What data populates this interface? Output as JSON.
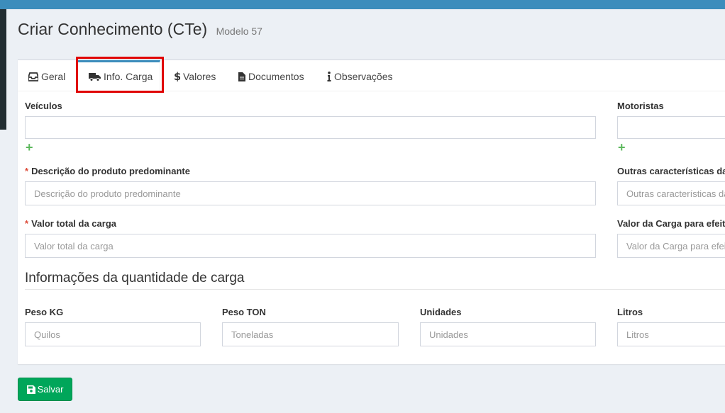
{
  "header": {
    "title": "Criar Conhecimento (CTe)",
    "subtitle": "Modelo 57"
  },
  "tabs": [
    {
      "label": "Geral",
      "icon": "inbox-icon"
    },
    {
      "label": "Info. Carga",
      "icon": "truck-icon"
    },
    {
      "label": "Valores",
      "icon": "dollar-icon"
    },
    {
      "label": "Documentos",
      "icon": "document-icon"
    },
    {
      "label": "Observações",
      "icon": "info-icon"
    }
  ],
  "fields": {
    "veiculos": {
      "label": "Veículos",
      "value": ""
    },
    "motoristas": {
      "label": "Motoristas",
      "value": ""
    },
    "descricao": {
      "label": "Descrição do produto predominante",
      "placeholder": "Descrição do produto predominante"
    },
    "outras": {
      "label": "Outras características da",
      "placeholder": "Outras características da"
    },
    "valor_total": {
      "label": "Valor total da carga",
      "placeholder": "Valor total da carga"
    },
    "valor_efeito": {
      "label": "Valor da Carga para efeito",
      "placeholder": "Valor da Carga para efeito"
    }
  },
  "required_mark": "*",
  "add_symbol": "+",
  "quantity": {
    "title": "Informações da quantidade de carga",
    "peso_kg": {
      "label": "Peso KG",
      "placeholder": "Quilos"
    },
    "peso_ton": {
      "label": "Peso TON",
      "placeholder": "Toneladas"
    },
    "unidades": {
      "label": "Unidades",
      "placeholder": "Unidades"
    },
    "litros": {
      "label": "Litros",
      "placeholder": "Litros"
    }
  },
  "footer": {
    "save_label": "Salvar"
  },
  "colors": {
    "accent": "#3c8dbc",
    "success": "#00a65a",
    "required": "#dd4b39",
    "highlight": "#e00000"
  }
}
